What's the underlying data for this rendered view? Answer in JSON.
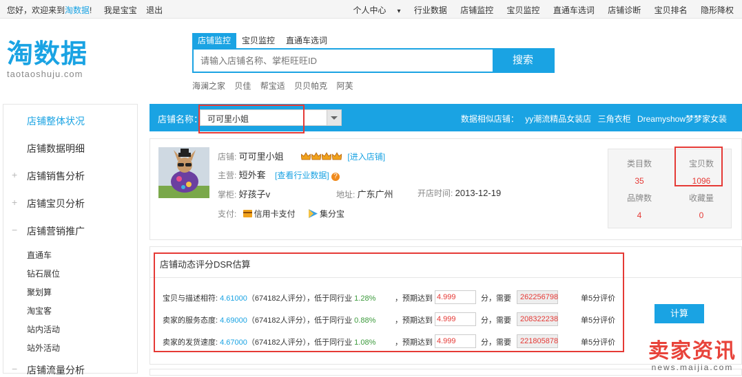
{
  "topbar": {
    "greeting_prefix": "您好，欢迎来到",
    "brand_link": "淘数据",
    "greeting_suffix": "!",
    "username": "我是宝宝",
    "logout": "退出",
    "nav": [
      "个人中心",
      "行业数据",
      "店铺监控",
      "宝贝监控",
      "直通车选词",
      "店铺诊断",
      "宝贝排名",
      "隐形降权"
    ]
  },
  "logo": {
    "cn": "淘数据",
    "en": "taotaoshuju.com"
  },
  "search": {
    "tabs": [
      "店铺监控",
      "宝贝监控",
      "直通车选词"
    ],
    "active_tab": 0,
    "placeholder": "请输入店铺名称、掌柜旺旺ID",
    "button": "搜索",
    "hot": [
      "海澜之家",
      "贝佳",
      "帮宝适",
      "贝贝帕克",
      "阿芙"
    ]
  },
  "sidebar": {
    "items": [
      {
        "label": "店铺整体状况",
        "active": true
      },
      {
        "label": "店铺数据明细"
      },
      {
        "label": "店铺销售分析",
        "expand": "+"
      },
      {
        "label": "店铺宝贝分析",
        "expand": "+"
      },
      {
        "label": "店铺营销推广",
        "expand": "−"
      }
    ],
    "subitems": [
      "直通车",
      "钻石展位",
      "聚划算",
      "淘宝客",
      "站内活动",
      "站外活动"
    ],
    "last_item": {
      "label": "店铺流量分析",
      "expand": "−"
    }
  },
  "shop_bar": {
    "label": "店铺名称：",
    "selected": "可可里小姐",
    "similar_label": "数据相似店铺：",
    "similar_shops": [
      "yy潮流精品女装店",
      "三角衣柜",
      "Dreamyshow梦梦家女装"
    ]
  },
  "shop": {
    "name_label": "店铺: ",
    "name": "可可里小姐",
    "enter": "[进入店铺]",
    "main_label": "主营: ",
    "main": "短外套",
    "industry_link": "[查看行业数据]",
    "keeper_label": "掌柜: ",
    "keeper": "好孩子v",
    "address_label": "地址: ",
    "address": "广东广州",
    "open_label": "开店时间: ",
    "open_date": "2013-12-19",
    "pay_label": "支付: ",
    "pay_methods": [
      "信用卡支付",
      "集分宝"
    ]
  },
  "stats": [
    {
      "label": "类目数",
      "value": "35"
    },
    {
      "label": "宝贝数",
      "value": "1096"
    },
    {
      "label": "品牌数",
      "value": "4"
    },
    {
      "label": "收藏量",
      "value": "0"
    }
  ],
  "dsr": {
    "title": "店铺动态评分DSR估算",
    "reach_label": "，预期达到",
    "need_label": "分，需要",
    "tail": "单5分评价",
    "rows": [
      {
        "label": "宝贝与描述相符: ",
        "score": "4.61000",
        "count": "（674182人评分），低于同行业 ",
        "diff": "1.28%",
        "target": "4.999",
        "needed": "262256798"
      },
      {
        "label": "卖家的服务态度: ",
        "score": "4.69000",
        "count": "（674182人评分），低于同行业 ",
        "diff": "0.88%",
        "target": "4.999",
        "needed": "208322238"
      },
      {
        "label": "卖家的发货速度: ",
        "score": "4.67000",
        "count": "（674182人评分），低于同行业 ",
        "diff": "1.08%",
        "target": "4.999",
        "needed": "221805878"
      }
    ],
    "calc_button": "计算"
  },
  "watermark": {
    "cn": "卖家资讯",
    "en": "news.maijia.com"
  },
  "colors": {
    "brand_blue": "#1aa3e3",
    "highlight_red": "#e53935",
    "orange": "#f08a1c",
    "positive_green": "#3c9a3c"
  }
}
